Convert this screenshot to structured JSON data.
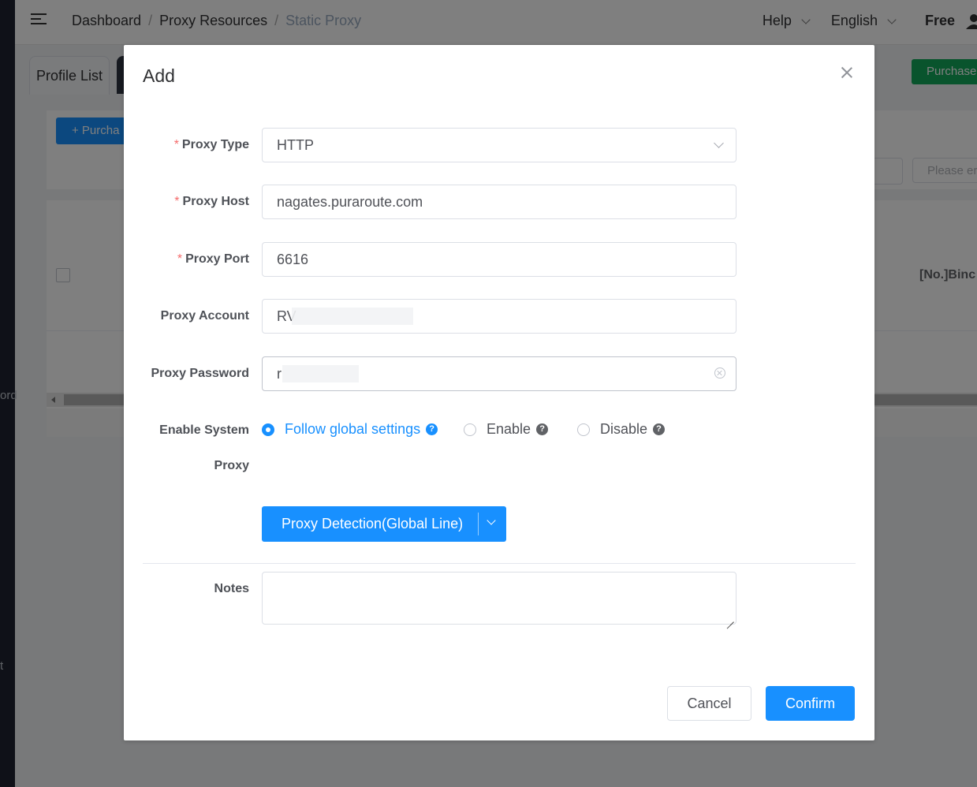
{
  "sidebar": {
    "fragment_1": "ord",
    "fragment_2": "t"
  },
  "header": {
    "breadcrumb": [
      "Dashboard",
      "Proxy Resources",
      "Static Proxy"
    ],
    "help_label": "Help",
    "language_label": "English",
    "plan_label": "Free"
  },
  "tabs": {
    "profile_list": "Profile List"
  },
  "page": {
    "purchase_top_label": "Purchase",
    "purchase_button_label": "+ Purcha",
    "search_placeholder": "Please er",
    "column_bind_label": "[No.]Binc"
  },
  "modal": {
    "title": "Add",
    "fields": {
      "proxy_type": {
        "label": "Proxy Type",
        "value": "HTTP",
        "required": true
      },
      "proxy_host": {
        "label": "Proxy Host",
        "value": "nagates.puraroute.com",
        "required": true
      },
      "proxy_port": {
        "label": "Proxy Port",
        "value": "6616",
        "required": true
      },
      "proxy_account": {
        "label": "Proxy Account",
        "value": "RV"
      },
      "proxy_password": {
        "label": "Proxy Password",
        "value": "r"
      }
    },
    "system_proxy": {
      "label_line1": "Enable System",
      "label_line2": "Proxy",
      "options": [
        "Follow global settings",
        "Enable",
        "Disable"
      ],
      "selected": "Follow global settings"
    },
    "detect_button_label": "Proxy Detection(Global Line)",
    "notes_label": "Notes",
    "notes_value": "",
    "cancel_label": "Cancel",
    "confirm_label": "Confirm",
    "required_mark": "*",
    "help_mark": "?"
  },
  "colors": {
    "primary": "#1890ff",
    "purchase_green": "#13a85b",
    "required": "#f56c6c"
  }
}
